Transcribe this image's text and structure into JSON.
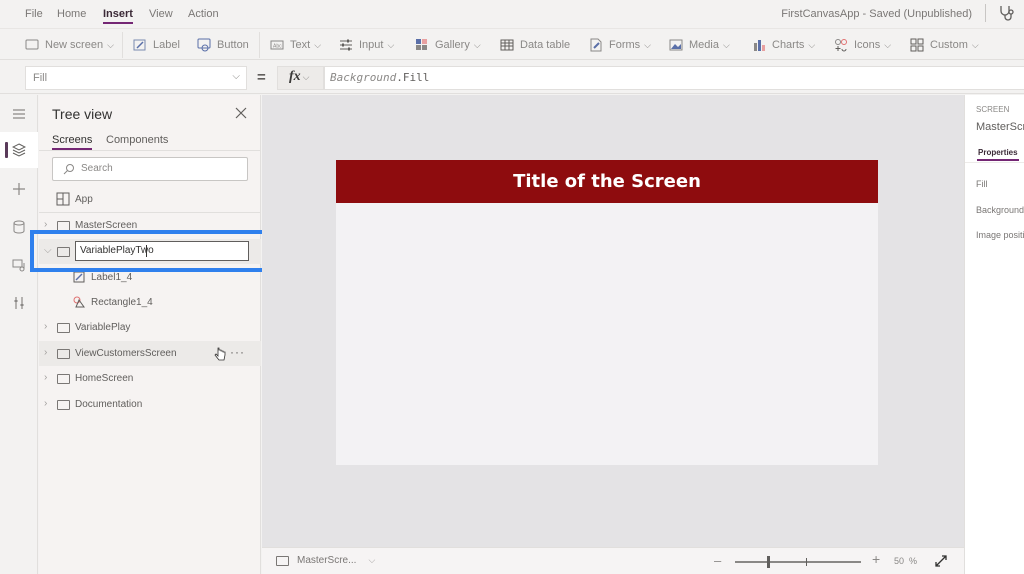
{
  "menu": {
    "items": [
      "File",
      "Home",
      "Insert",
      "View",
      "Action"
    ],
    "active": "Insert",
    "app_status": "FirstCanvasApp - Saved (Unpublished)"
  },
  "ribbon": {
    "items": [
      {
        "label": "New screen",
        "icon": "new-screen-icon",
        "dropdown": true
      },
      {
        "label": "Label",
        "icon": "label-icon",
        "dropdown": false
      },
      {
        "label": "Button",
        "icon": "button-icon",
        "dropdown": false
      },
      {
        "label": "Text",
        "icon": "text-icon",
        "dropdown": true
      },
      {
        "label": "Input",
        "icon": "input-icon",
        "dropdown": true
      },
      {
        "label": "Gallery",
        "icon": "gallery-icon",
        "dropdown": true
      },
      {
        "label": "Data table",
        "icon": "data-table-icon",
        "dropdown": false
      },
      {
        "label": "Forms",
        "icon": "forms-icon",
        "dropdown": true
      },
      {
        "label": "Media",
        "icon": "media-icon",
        "dropdown": true
      },
      {
        "label": "Charts",
        "icon": "charts-icon",
        "dropdown": true
      },
      {
        "label": "Icons",
        "icon": "icons-icon",
        "dropdown": true
      },
      {
        "label": "Custom",
        "icon": "custom-icon",
        "dropdown": true
      }
    ]
  },
  "formula_bar": {
    "property": "Fill",
    "equals": "=",
    "fx_label": "fx",
    "formula_object": "Background",
    "formula_rest": ".Fill"
  },
  "tree_view": {
    "title": "Tree view",
    "tabs": [
      "Screens",
      "Components"
    ],
    "active_tab": "Screens",
    "search_placeholder": "Search",
    "app_label": "App",
    "rows": [
      {
        "label": "MasterScreen",
        "expanded": false,
        "type": "screen"
      },
      {
        "label": "VariablePlayTwo",
        "expanded": true,
        "type": "screen",
        "renaming": true
      },
      {
        "label": "Label1_4",
        "type": "label",
        "child": true
      },
      {
        "label": "Rectangle1_4",
        "type": "rectangle",
        "child": true
      },
      {
        "label": "VariablePlay",
        "expanded": false,
        "type": "screen"
      },
      {
        "label": "ViewCustomersScreen",
        "expanded": false,
        "type": "screen",
        "hover": true
      },
      {
        "label": "HomeScreen",
        "expanded": false,
        "type": "screen"
      },
      {
        "label": "Documentation",
        "expanded": false,
        "type": "screen"
      }
    ],
    "rename_value": "VariablePlayTwo",
    "more_label": "···"
  },
  "canvas": {
    "screen_title": "Title of the Screen",
    "title_bar_color": "#8e0c0e",
    "highlight_color": "#2f80ed"
  },
  "bottom_bar": {
    "screen_name": "MasterScre...",
    "zoom_value": "50",
    "zoom_unit": "%",
    "zoom_fraction": 0.25
  },
  "properties": {
    "type_label": "SCREEN",
    "name": "MasterScreen",
    "tab": "Properties",
    "rows": [
      "Fill",
      "Background image",
      "Image position"
    ]
  }
}
